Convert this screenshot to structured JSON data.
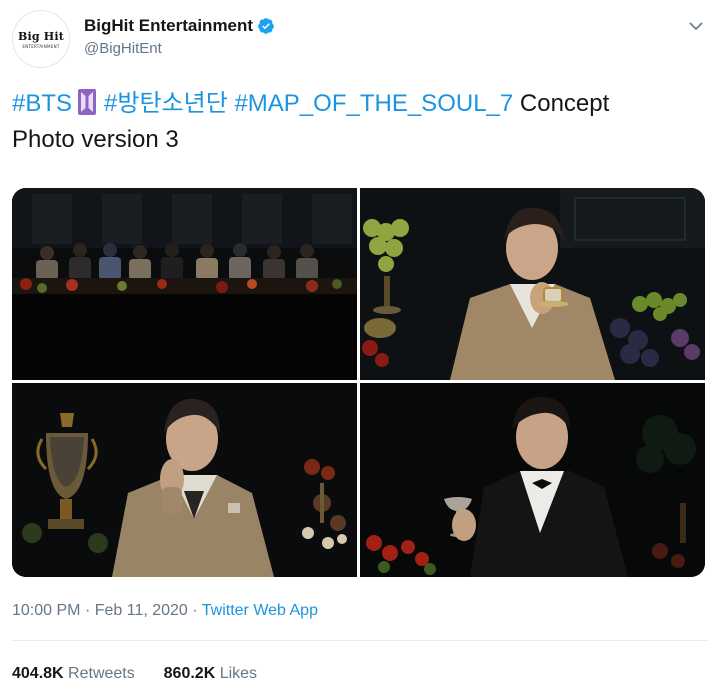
{
  "account": {
    "display_name": "BigHit Entertainment",
    "handle": "@BigHitEnt",
    "avatar_logo": "Big Hit",
    "avatar_sub": "ENTERTAINMENT",
    "verified": true
  },
  "tweet": {
    "hashtag_1": "#BTS",
    "hashtag_2": "#방탄소년단",
    "hashtag_3": "#MAP_OF_THE_SOUL_7",
    "text_tail": "Concept",
    "text_line2": "Photo version 3",
    "emoji_icon": "purple-bts-logo-icon"
  },
  "media": {
    "count": 4,
    "photos": [
      "group-table-photo",
      "member-teacup-photo",
      "member-trophy-photo",
      "member-goblet-photo"
    ]
  },
  "meta": {
    "time": "10:00 PM",
    "date": "Feb 11, 2020",
    "separator": "·",
    "source": "Twitter Web App"
  },
  "stats": {
    "retweets_count": "404.8K",
    "retweets_label": "Retweets",
    "likes_count": "860.2K",
    "likes_label": "Likes"
  },
  "colors": {
    "link": "#1b95e0",
    "muted": "#657786",
    "text": "#14171a",
    "verified": "#1da1f2",
    "purple": "#8f63c4"
  }
}
